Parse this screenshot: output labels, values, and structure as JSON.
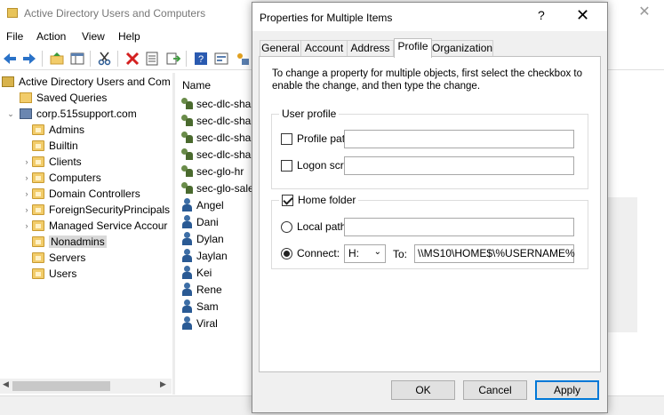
{
  "app": {
    "title": "Active Directory Users and Computers",
    "close_glyph": "✕"
  },
  "menu": [
    "File",
    "Action",
    "View",
    "Help"
  ],
  "toolbar": {
    "icons": [
      "back-arrow-icon",
      "forward-arrow-icon",
      "folder-up-icon",
      "console-tree-icon",
      "cut-icon",
      "delete-icon",
      "properties-icon",
      "export-icon",
      "help-icon",
      "console-icon",
      "wizard-icon"
    ]
  },
  "tree": {
    "root": "Active Directory Users and Com",
    "saved_queries": "Saved Queries",
    "domain": "corp.515support.com",
    "ous": [
      {
        "label": "Admins",
        "expandable": false
      },
      {
        "label": "Builtin",
        "expandable": false
      },
      {
        "label": "Clients",
        "expandable": true
      },
      {
        "label": "Computers",
        "expandable": true
      },
      {
        "label": "Domain Controllers",
        "expandable": true
      },
      {
        "label": "ForeignSecurityPrincipals",
        "expandable": true
      },
      {
        "label": "Managed Service Accour",
        "expandable": true
      },
      {
        "label": "Nonadmins",
        "expandable": false,
        "selected": true
      },
      {
        "label": "Servers",
        "expandable": false
      },
      {
        "label": "Users",
        "expandable": false
      }
    ],
    "glyphs": {
      "expanded": "⌄",
      "collapsed": "›",
      "scroll_left": "◀",
      "scroll_right": "▶"
    }
  },
  "list": {
    "header": "Name",
    "items": [
      {
        "name": "sec-dlc-shar",
        "type": "group"
      },
      {
        "name": "sec-dlc-shar",
        "type": "group"
      },
      {
        "name": "sec-dlc-shar",
        "type": "group"
      },
      {
        "name": "sec-dlc-shar",
        "type": "group"
      },
      {
        "name": "sec-glo-hr",
        "type": "group"
      },
      {
        "name": "sec-glo-sale",
        "type": "group"
      },
      {
        "name": "Angel",
        "type": "user"
      },
      {
        "name": "Dani",
        "type": "user"
      },
      {
        "name": "Dylan",
        "type": "user"
      },
      {
        "name": "Jaylan",
        "type": "user"
      },
      {
        "name": "Kei",
        "type": "user"
      },
      {
        "name": "Rene",
        "type": "user"
      },
      {
        "name": "Sam",
        "type": "user"
      },
      {
        "name": "Viral",
        "type": "user"
      }
    ]
  },
  "dialog": {
    "title": "Properties for Multiple Items",
    "help_glyph": "?",
    "close_glyph": "✕",
    "tabs": [
      "General",
      "Account",
      "Address",
      "Profile",
      "Organization"
    ],
    "active_tab": "Profile",
    "intro": "To change a property for multiple objects, first select the checkbox to enable the change, and then type the change.",
    "user_profile": {
      "legend": "User profile",
      "profile_path": {
        "label": "Profile path:",
        "checked": false,
        "value": ""
      },
      "logon_script": {
        "label": "Logon script:",
        "checked": false,
        "value": ""
      }
    },
    "home_folder": {
      "legend": "Home folder",
      "checked": true,
      "local_path": {
        "label": "Local path:",
        "selected": false,
        "value": ""
      },
      "connect": {
        "label": "Connect:",
        "selected": true,
        "drive": "H:",
        "to_label": "To:",
        "path": "\\\\MS10\\HOME$\\%USERNAME%"
      },
      "chevron": "⌄"
    },
    "buttons": {
      "ok": "OK",
      "cancel": "Cancel",
      "apply": "Apply"
    }
  },
  "colors": {
    "accent": "#0078d7",
    "selection": "#d9d9d9"
  }
}
